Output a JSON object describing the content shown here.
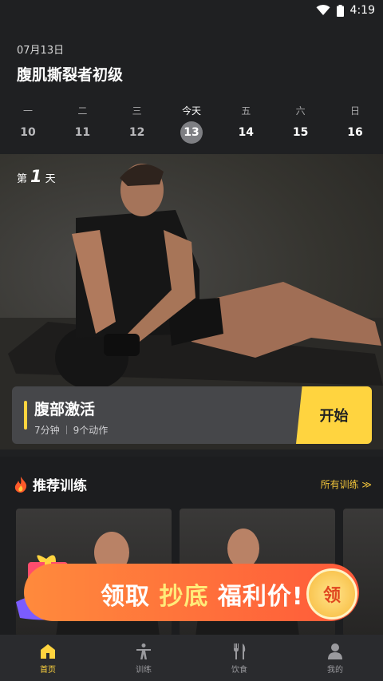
{
  "status": {
    "time": "4:19"
  },
  "header": {
    "date": "07月13日",
    "title": "腹肌撕裂者初级"
  },
  "week": [
    {
      "label": "一",
      "day": "10"
    },
    {
      "label": "二",
      "day": "11"
    },
    {
      "label": "三",
      "day": "12"
    },
    {
      "label": "今天",
      "day": "13"
    },
    {
      "label": "五",
      "day": "14"
    },
    {
      "label": "六",
      "day": "15"
    },
    {
      "label": "日",
      "day": "16"
    }
  ],
  "hero": {
    "day_prefix": "第",
    "day_number": "1",
    "day_suffix": "天"
  },
  "workout": {
    "name": "腹部激活",
    "duration": "7分钟",
    "moves": "9个动作",
    "start_label": "开始"
  },
  "recommend": {
    "title": "推荐训练",
    "all_label": "所有训练 ≫"
  },
  "promo": {
    "text_prefix": "领取",
    "text_accent": "抄底",
    "text_suffix": "福利价!",
    "badge": "领"
  },
  "tabs": [
    {
      "label": "首页",
      "icon": "home-icon"
    },
    {
      "label": "训练",
      "icon": "training-icon"
    },
    {
      "label": "饮食",
      "icon": "diet-icon"
    },
    {
      "label": "我的",
      "icon": "profile-icon"
    }
  ],
  "colors": {
    "accent": "#ffd43f",
    "background": "#1f2022"
  }
}
